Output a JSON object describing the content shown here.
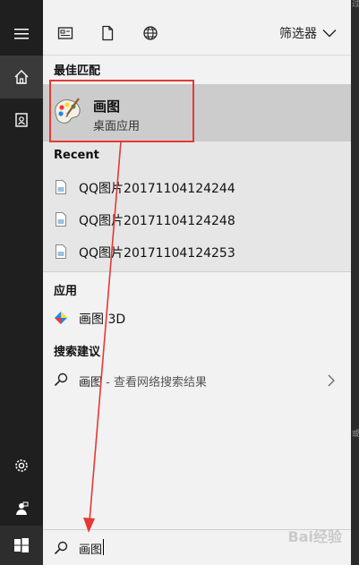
{
  "desktop": {
    "frag_top": "过",
    "frag_mid": "或"
  },
  "rail": {
    "menu_icon": "hamburger-icon",
    "home_icon": "home-icon",
    "docs_icon": "documents-icon",
    "settings_icon": "gear-icon",
    "feedback_icon": "feedback-icon",
    "start_icon": "windows-logo-icon"
  },
  "topbar": {
    "icons": [
      "apps-filter-icon",
      "documents-filter-icon",
      "web-filter-icon"
    ],
    "filter_label": "筛选器"
  },
  "best_match": {
    "heading": "最佳匹配",
    "name": "画图",
    "type": "桌面应用",
    "icon": "paint-palette-icon"
  },
  "recent": {
    "heading": "Recent",
    "items": [
      {
        "label": "QQ图片20171104124244"
      },
      {
        "label": "QQ图片20171104124248"
      },
      {
        "label": "QQ图片20171104124253"
      }
    ]
  },
  "apps": {
    "heading": "应用",
    "items": [
      {
        "label": "画图 3D",
        "icon": "paint3d-icon"
      }
    ]
  },
  "suggestions": {
    "heading": "搜索建议",
    "items": [
      {
        "term": "画图",
        "hint": " - 查看网络搜索结果"
      }
    ]
  },
  "search": {
    "query": "画图"
  },
  "watermark": "Bai经验",
  "colors": {
    "annotation": "#e53935",
    "selected": "#cccccc",
    "panel": "#f2f2f2",
    "rail": "#1f1f1f"
  }
}
